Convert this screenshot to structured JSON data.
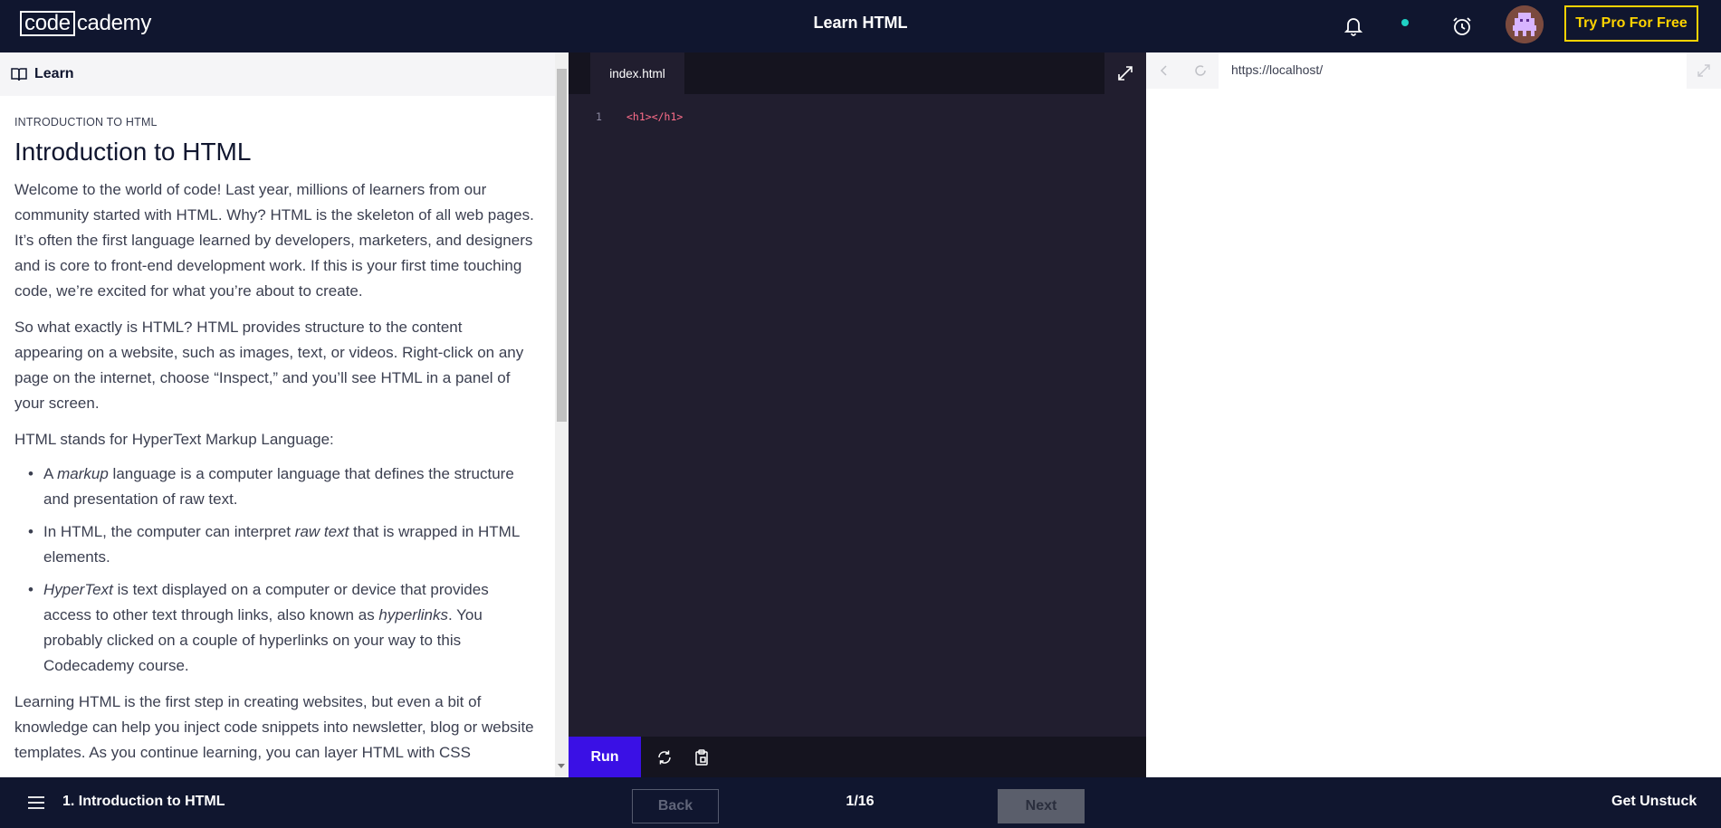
{
  "header": {
    "logo_box": "code",
    "logo_rest": "cademy",
    "title": "Learn HTML",
    "pro_button": "Try Pro For Free",
    "icons": [
      "bell-icon",
      "status-dot",
      "alarm-clock-icon",
      "avatar"
    ]
  },
  "lesson": {
    "panel_label": "Learn",
    "breadcrumb": "INTRODUCTION TO HTML",
    "heading": "Introduction to HTML",
    "para1": "Welcome to the world of code! Last year, millions of learners from our community started with HTML. Why? HTML is the skeleton of all web pages. It’s often the first language learned by developers, marketers, and designers and is core to front-end development work. If this is your first time touching code, we’re excited for what you’re about to create.",
    "para2": "So what exactly is HTML? HTML provides structure to the content appearing on a website, such as images, text, or videos. Right-click on any page on the internet, choose “Inspect,” and you’ll see HTML in a panel of your screen.",
    "para3": "HTML stands for HyperText Markup Language:",
    "bullets": [
      {
        "pre": "A ",
        "em": "markup",
        "post": " language is a computer language that defines the structure and presentation of raw text."
      },
      {
        "pre": "In HTML, the computer can interpret ",
        "em": "raw text",
        "post": " that is wrapped in HTML elements."
      },
      {
        "em": "HyperText",
        "mid": " is text displayed on a computer or device that provides access to other text through links, also known as ",
        "em2": "hyperlinks",
        "post": ". You probably clicked on a couple of hyperlinks on your way to this Codecademy course."
      }
    ],
    "para4": "Learning HTML is the first step in creating websites, but even a bit of knowledge can help you inject code snippets into newsletter, blog or website templates. As you continue learning, you can layer HTML with CSS"
  },
  "editor": {
    "tab": "index.html",
    "line_number": "1",
    "code": "<h1></h1>",
    "run_label": "Run"
  },
  "browser": {
    "url": "https://localhost/"
  },
  "footer": {
    "lesson_name": "1. Introduction to HTML",
    "back_label": "Back",
    "progress": "1/16",
    "next_label": "Next",
    "unstuck_label": "Get Unstuck"
  },
  "colors": {
    "nav_bg": "#10162f",
    "editor_bg": "#211e2f",
    "run_button": "#3a10e5",
    "pro_accent": "#ffd300",
    "code_tag": "#ff6e8a",
    "status_dot": "#1fd1c4"
  }
}
